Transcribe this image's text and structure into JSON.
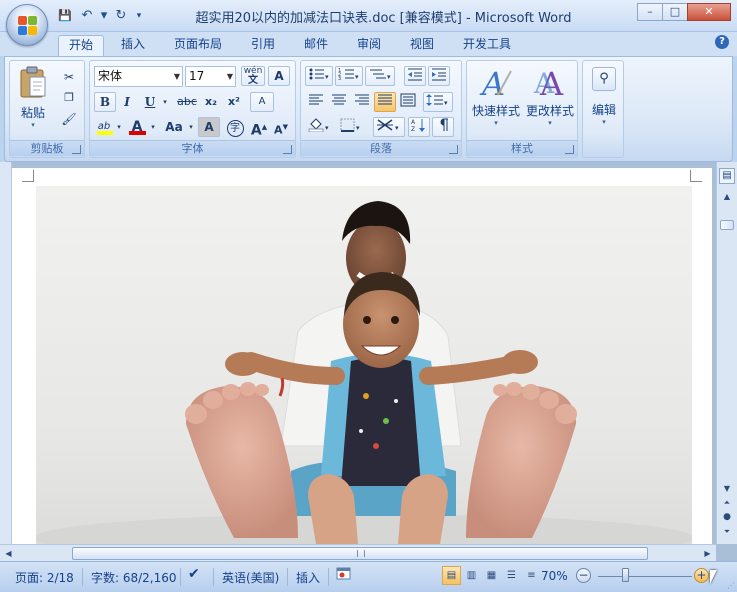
{
  "window": {
    "title": "超实用20以内的加减法口诀表.doc [兼容模式] - Microsoft Word",
    "minimize": "–",
    "maximize": "□",
    "close": "✕"
  },
  "qat": {
    "save": "💾",
    "undo": "↶",
    "redo": "↻",
    "customize": "▾"
  },
  "tabs": [
    "开始",
    "插入",
    "页面布局",
    "引用",
    "邮件",
    "审阅",
    "视图",
    "开发工具"
  ],
  "active_tab": 0,
  "help": "?",
  "ribbon": {
    "clipboard": {
      "label": "剪贴板",
      "paste": "粘贴"
    },
    "font": {
      "label": "字体",
      "font_name": "宋体",
      "font_size": "17",
      "grow": "A",
      "shrink": "A",
      "bold": "B",
      "italic": "I",
      "underline": "U",
      "strike": "abc",
      "subscript": "x₂",
      "superscript": "x²",
      "highlight": "ab",
      "font_color": "A",
      "change_case": "Aa",
      "char_shading": "A",
      "enclose": "字",
      "phonetic": "wén",
      "char_border": "A",
      "clear": "A"
    },
    "paragraph": {
      "label": "段落"
    },
    "styles": {
      "label": "样式",
      "quick_styles": "快速样式",
      "change_styles": "更改样式"
    },
    "editing": {
      "label": "编辑"
    }
  },
  "statusbar": {
    "page": "页面: 2/18",
    "words": "字数: 68/2,160",
    "language": "英语(美国)",
    "insert_mode": "插入",
    "zoom": "70%",
    "zoom_out": "−",
    "zoom_in": "+"
  },
  "colors": {
    "highlight": "#ffff00",
    "font_color": "#e00000",
    "accent": "#15428b"
  }
}
